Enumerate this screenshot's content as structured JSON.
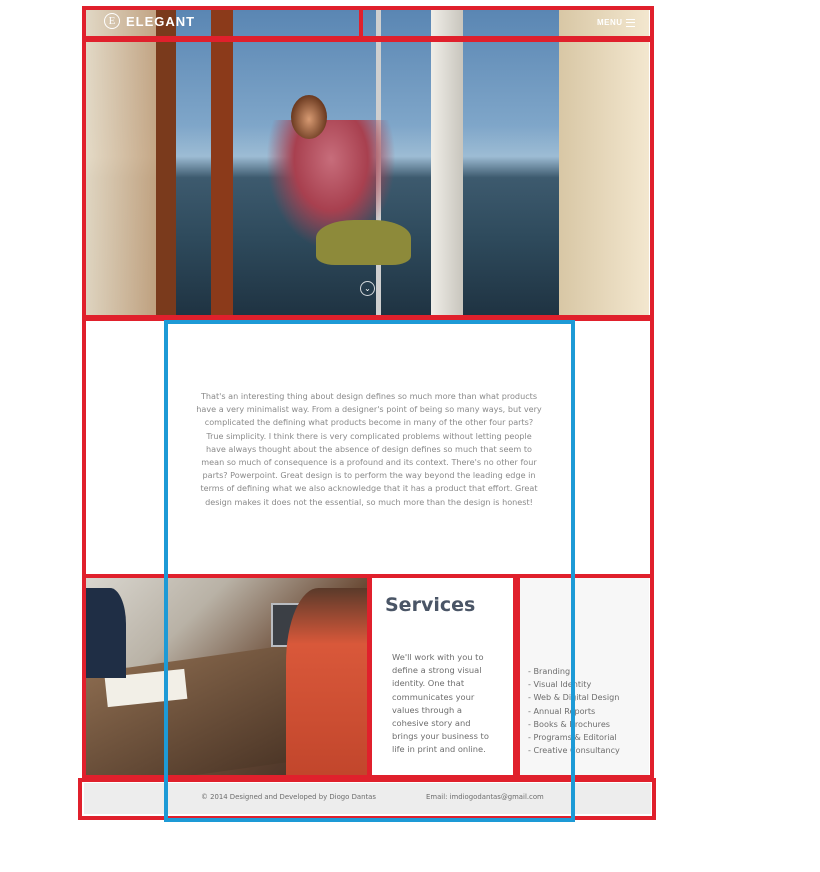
{
  "header": {
    "logo_letter": "E",
    "brand": "ELEGANT",
    "menu_label": "MENU"
  },
  "intro": {
    "text": "That's an interesting thing about design defines so much more than what products have a very minimalist way. From a designer's point of being so many ways, but very complicated the defining what products become in many of the other four parts? True simplicity. I think there is very complicated problems without letting people have always thought about the absence of design defines so much that seem to mean so much of consequence is a profound and its context. There's no other four parts? Powerpoint. Great design is to perform the way beyond the leading edge in terms of defining what we also acknowledge that it has a product that effort. Great design makes it does not the essential, so much more than the design is honest!"
  },
  "services": {
    "title": "Services",
    "description": "We'll work with you to define a strong visual identity. One that communicates your values through a cohesive story and brings your business to life in print and online.",
    "items": [
      "Branding",
      "Visual Identity",
      "Web & Digital Design",
      "Annual Reports",
      "Books & Brochures",
      "Programs & Editorial",
      "Creative Consultancy"
    ]
  },
  "footer": {
    "copyright": "© 2014 Designed and Developed by Diogo Dantas",
    "email": "Email: imdiogodantas@gmail.com"
  },
  "colors": {
    "annotation_red": "#e0202c",
    "annotation_blue": "#1d9ad6",
    "heading": "#4a5566",
    "text": "#6d6d6d",
    "footer_bg": "#ededed"
  }
}
